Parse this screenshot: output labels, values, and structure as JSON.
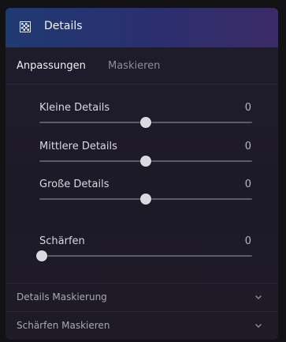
{
  "header": {
    "title": "Details",
    "icon": "checker-icon"
  },
  "tabs": [
    {
      "label": "Anpassungen",
      "active": true
    },
    {
      "label": "Maskieren",
      "active": false
    }
  ],
  "sliders": [
    {
      "label": "Kleine Details",
      "value": "0",
      "level": 0.5
    },
    {
      "label": "Mittlere Details",
      "value": "0",
      "level": 0.5
    },
    {
      "label": "Große Details",
      "value": "0",
      "level": 0.5
    },
    {
      "label": "Schärfen",
      "value": "0",
      "level": 0.0
    }
  ],
  "sections": [
    {
      "label": "Details Maskierung"
    },
    {
      "label": "Schärfen Maskieren"
    }
  ],
  "colors": {
    "header_start": "#1f3a73",
    "header_end": "#3b2b67",
    "panel_bg": "#1e1b28",
    "thumb": "#d9d9df"
  }
}
